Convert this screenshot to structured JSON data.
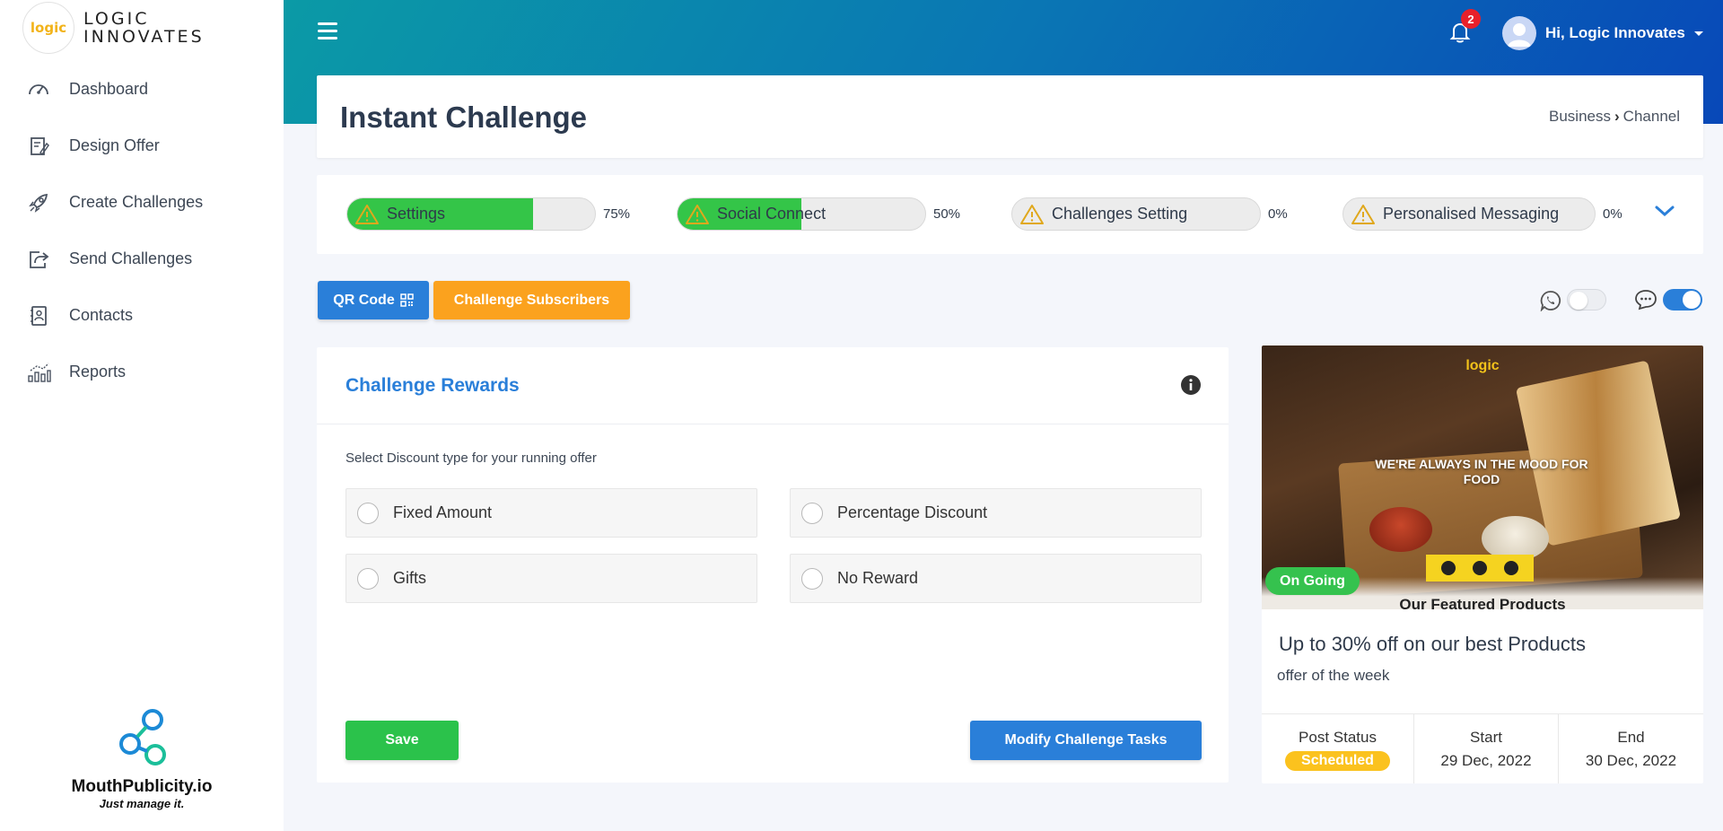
{
  "brand": {
    "logo_text": "logic",
    "name_line1": "LOGIC",
    "name_line2": "INNOVATES"
  },
  "sidebar": {
    "items": [
      {
        "label": "Dashboard",
        "icon": "speedometer-icon"
      },
      {
        "label": "Design Offer",
        "icon": "design-icon"
      },
      {
        "label": "Create Challenges",
        "icon": "rocket-icon"
      },
      {
        "label": "Send Challenges",
        "icon": "share-icon"
      },
      {
        "label": "Contacts",
        "icon": "contact-book-icon"
      },
      {
        "label": "Reports",
        "icon": "reports-chart-icon"
      }
    ],
    "footer": {
      "name": "MouthPublicity.io",
      "tagline": "Just manage it."
    }
  },
  "header": {
    "notification_count": "2",
    "user_greeting": "Hi, Logic Innovates"
  },
  "page": {
    "title": "Instant Challenge",
    "breadcrumb": [
      "Business",
      "Channel"
    ]
  },
  "progress": [
    {
      "label": "Settings",
      "percent_text": "75%",
      "value": 0.75
    },
    {
      "label": "Social Connect",
      "percent_text": "50%",
      "value": 0.5
    },
    {
      "label": "Challenges Setting",
      "percent_text": "0%",
      "value": 0
    },
    {
      "label": "Personalised Messaging",
      "percent_text": "0%",
      "value": 0
    }
  ],
  "actions": {
    "qr_label": "QR Code",
    "subscribers_label": "Challenge Subscribers"
  },
  "toggles": {
    "whatsapp_on": false,
    "sms_on": true
  },
  "rewards": {
    "title": "Challenge Rewards",
    "subtitle": "Select Discount type for your running offer",
    "options": [
      "Fixed Amount",
      "Percentage Discount",
      "Gifts",
      "No Reward"
    ],
    "save_label": "Save",
    "modify_label": "Modify Challenge Tasks"
  },
  "offer": {
    "image_brand": "logic",
    "image_slogan": "WE'RE ALWAYS IN THE MOOD FOR FOOD",
    "image_featured": "Our Featured Products",
    "status_badge": "On Going",
    "title": "Up to 30% off on our best Products",
    "subtitle": "offer of the week",
    "meta": {
      "post_status_label": "Post Status",
      "post_status_value": "Scheduled",
      "start_label": "Start",
      "start_value": "29 Dec, 2022",
      "end_label": "End",
      "end_value": "30 Dec, 2022"
    }
  },
  "colors": {
    "primary": "#2a7fd9",
    "success": "#34c548",
    "warning": "#fba21e",
    "badge_red": "#e8202a",
    "scheduled": "#fbc21e"
  }
}
